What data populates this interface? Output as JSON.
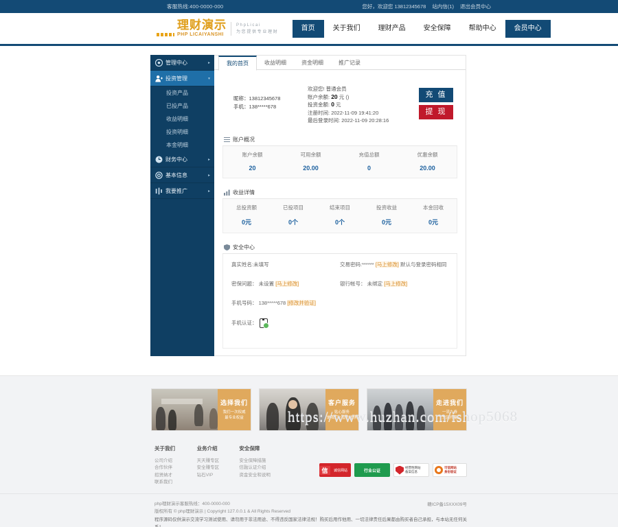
{
  "topbar": {
    "hotline": "客服热线:400-0000-000",
    "greeting": "您好，欢迎您 13812345678",
    "inbox": "站内信(1)",
    "logout": "退出会员中心"
  },
  "logo": {
    "cn": "理财演示",
    "en": "PHP LICAIYANSHI",
    "slogan_line1": "P h p  L i c a i",
    "slogan_line2": "为 您 提 供 专 业 理 财"
  },
  "nav": [
    {
      "label": "首页",
      "state": "active"
    },
    {
      "label": "关于我们",
      "state": ""
    },
    {
      "label": "理财产品",
      "state": ""
    },
    {
      "label": "安全保障",
      "state": ""
    },
    {
      "label": "帮助中心",
      "state": ""
    },
    {
      "label": "会员中心",
      "state": "highlight"
    }
  ],
  "sidebar": {
    "groups": [
      {
        "label": "管理中心",
        "icon": "target-icon",
        "active": false,
        "arrow": "▸",
        "children": []
      },
      {
        "label": "投资管理",
        "icon": "user-add-icon",
        "active": true,
        "arrow": "▾",
        "children": [
          "投资产品",
          "已投产品",
          "收益明细",
          "投资明细",
          "本金明细"
        ]
      },
      {
        "label": "财务中心",
        "icon": "clock-icon",
        "active": false,
        "arrow": "▸",
        "children": []
      },
      {
        "label": "基本信息",
        "icon": "gear-icon",
        "active": false,
        "arrow": "▸",
        "children": []
      },
      {
        "label": "我要推广",
        "icon": "share-icon",
        "active": false,
        "arrow": "▸",
        "children": []
      }
    ]
  },
  "tabs": [
    {
      "label": "我的首页",
      "active": true
    },
    {
      "label": "收益明细",
      "active": false
    },
    {
      "label": "资金明细",
      "active": false
    },
    {
      "label": "推广记录",
      "active": false
    }
  ],
  "account": {
    "nickname_label": "昵称：",
    "nickname": "13812345678",
    "phone_label": "手机：",
    "phone": "138*****678",
    "welcome": "欢迎您!  普通会员",
    "balance_label": "账户余额:",
    "balance_value": "20",
    "balance_unit": "元 ()",
    "invest_label": "投资金额:",
    "invest_value": "0",
    "invest_unit": "元",
    "reg_time_label": "注册时间:",
    "reg_time": "2022-11-09 19:41:20",
    "last_login_label": "最后登录时间:",
    "last_login": "2022-11-09 20:28:16",
    "recharge_btn": "充 值",
    "withdraw_btn": "提 现"
  },
  "account_overview": {
    "title": "账户概况",
    "icon": "list-icon",
    "stats": [
      {
        "label": "账户余额",
        "value": "20"
      },
      {
        "label": "可用余额",
        "value": "20.00"
      },
      {
        "label": "充值总额",
        "value": "0"
      },
      {
        "label": "优惠余额",
        "value": "20.00"
      }
    ]
  },
  "earnings": {
    "title": "收益详情",
    "icon": "chart-icon",
    "stats": [
      {
        "label": "总投资额",
        "value": "0元"
      },
      {
        "label": "已投项目",
        "value": "0个"
      },
      {
        "label": "结束项目",
        "value": "0个"
      },
      {
        "label": "投资收益",
        "value": "0元"
      },
      {
        "label": "本金回收",
        "value": "0元"
      }
    ]
  },
  "security": {
    "title": "安全中心",
    "icon": "shield-icon",
    "real_name": "真实姓名:未填写",
    "trade_pwd": "交易密码:******",
    "trade_pwd_link": "[马上修改]",
    "trade_pwd_note": "默认与登录密码相同",
    "secret_q": "密保问题：  未设置",
    "secret_q_link": "[马上修改]",
    "bank": "银行帐号：  未绑定",
    "bank_link": "[马上修改]",
    "mobile": "手机号码：  138*****678",
    "mobile_link": "[修改并验证]",
    "mobile_auth": "手机认证：",
    "mobile_auth_icon": "phone-verified-icon"
  },
  "promos": [
    {
      "title": "选择我们",
      "sub1": "我们一次权威",
      "sub2": "最专业权益",
      "image": "meeting-room-photo"
    },
    {
      "title": "客户服务",
      "sub1": "贴心服务",
      "sub2": "是我们一直的追求",
      "image": "business-people-photo"
    },
    {
      "title": "走进我们",
      "sub1": "一流九券",
      "sub2": "只因托量",
      "image": "team-cheering-photo"
    }
  ],
  "footer_links": [
    {
      "head": "关于我们",
      "items": [
        "公司介绍",
        "合作伙伴",
        "招贤纳才",
        "联系我们"
      ]
    },
    {
      "head": "业务介绍",
      "items": [
        "天天赚专区",
        "安全赚专区",
        "钻石VIP"
      ]
    },
    {
      "head": "安全保障",
      "items": [
        "安全保障措施",
        "信融认证介绍",
        "资金安全和说明"
      ]
    }
  ],
  "badges": [
    {
      "name": "credit-website-badge",
      "mark": "信",
      "text": "诚信网站"
    },
    {
      "name": "industry-notary-badge",
      "text": "行业公证"
    },
    {
      "name": "business-site-record-badge",
      "text": "经营性网站\n备案信息"
    },
    {
      "name": "trusted-site-badge",
      "text": "可信网站\n身份验证"
    }
  ],
  "watermark": "https://www.huzhan.com/ishop5068",
  "copyright": {
    "line1": "php理财演示客服热线：400-0000-000",
    "line2": "版权所有 © php理财演示 | Copyright 127.0.0.1 & All Rights Reserved",
    "disclaimer": "程序源码仅供演示交流学习测试使用、请勿用于非法用途、不得违反国家法律法规！购买后用作他用、一切法律责任后果都由购买者自己承担，与本站无任何关系！",
    "icp": "赣ICP备15XXX09号"
  },
  "colors": {
    "brand_blue": "#124a75",
    "sidebar_blue": "#0f3f63",
    "active_blue": "#1f6fa8",
    "red": "#c0192b",
    "gold": "#e0a95d",
    "stat_value": "#1a5f9e"
  }
}
